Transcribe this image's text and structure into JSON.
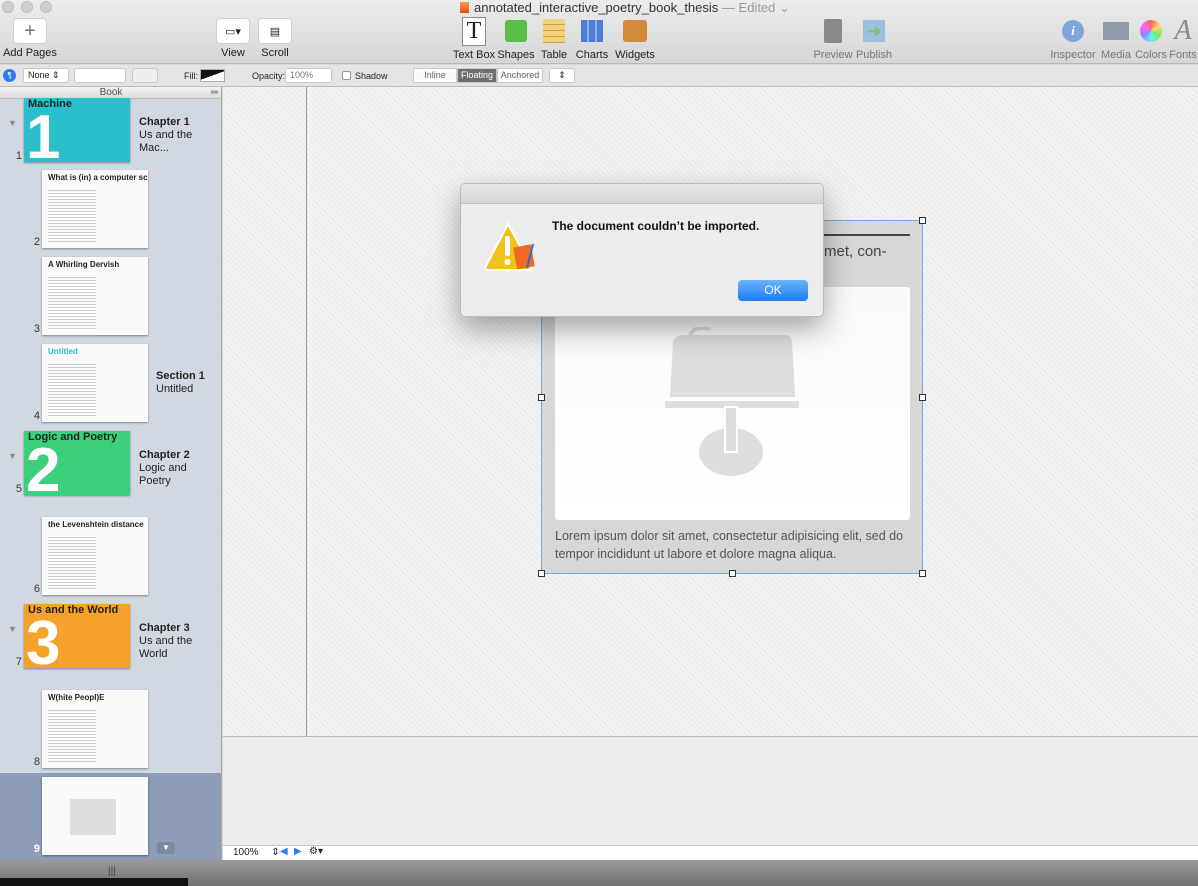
{
  "window": {
    "title": "annotated_interactive_poetry_book_thesis",
    "status": "— Edited"
  },
  "toolbar": {
    "add_pages": "Add Pages",
    "view": "View",
    "scroll": "Scroll",
    "text_box": "Text Box",
    "shapes": "Shapes",
    "table": "Table",
    "charts": "Charts",
    "widgets": "Widgets",
    "preview": "Preview",
    "publish": "Publish",
    "inspector": "Inspector",
    "media": "Media",
    "colors": "Colors",
    "fonts": "Fonts"
  },
  "format_bar": {
    "style_value": "None",
    "fill_label": "Fill:",
    "opacity_label": "Opacity:",
    "opacity_value": "100%",
    "shadow_label": "Shadow",
    "shadow_checked": false,
    "wrap_options": [
      "Inline",
      "Floating",
      "Anchored"
    ],
    "wrap_selected": "Floating"
  },
  "sidebar": {
    "header": "Book",
    "pages": [
      {
        "num": "1",
        "type": "chapter",
        "thumb_title": "Machine",
        "thumb_number": "1",
        "color": "#2bbfcc",
        "label_title": "Chapter 1",
        "label_sub": "Us and the Mac..."
      },
      {
        "num": "2",
        "type": "page",
        "thumb_title": "What is (in) a computer screen"
      },
      {
        "num": "3",
        "type": "page",
        "thumb_title": "A Whirling Dervish"
      },
      {
        "num": "4",
        "type": "section",
        "thumb_title": "Untitled",
        "label_title": "Section 1",
        "label_sub": "Untitled"
      },
      {
        "num": "5",
        "type": "chapter",
        "thumb_title": "Logic and Poetry",
        "thumb_number": "2",
        "color": "#3ccf7c",
        "label_title": "Chapter 2",
        "label_sub": "Logic and Poetry"
      },
      {
        "num": "6",
        "type": "page",
        "thumb_title": "the Levenshtein distance"
      },
      {
        "num": "7",
        "type": "chapter",
        "thumb_title": "Us and the World",
        "thumb_number": "3",
        "color": "#f5a12a",
        "label_title": "Chapter 3",
        "label_sub": "Us and the World"
      },
      {
        "num": "8",
        "type": "page",
        "thumb_title": "W(hite Peopl)E"
      },
      {
        "num": "9",
        "type": "page",
        "thumb_title": "",
        "selected": true
      }
    ]
  },
  "canvas": {
    "partial_text": "met, con-",
    "caption": "Lorem ipsum dolor sit amet, consectetur adipisicing elit, sed do tempor incididunt ut labore et dolore magna aliqua."
  },
  "dialog": {
    "message": "The document couldn’t be imported.",
    "ok_label": "OK"
  },
  "bottom_bar": {
    "zoom": "100%"
  },
  "colors": {
    "accent": "#1a7cf5",
    "selection": "#6aaee8"
  }
}
